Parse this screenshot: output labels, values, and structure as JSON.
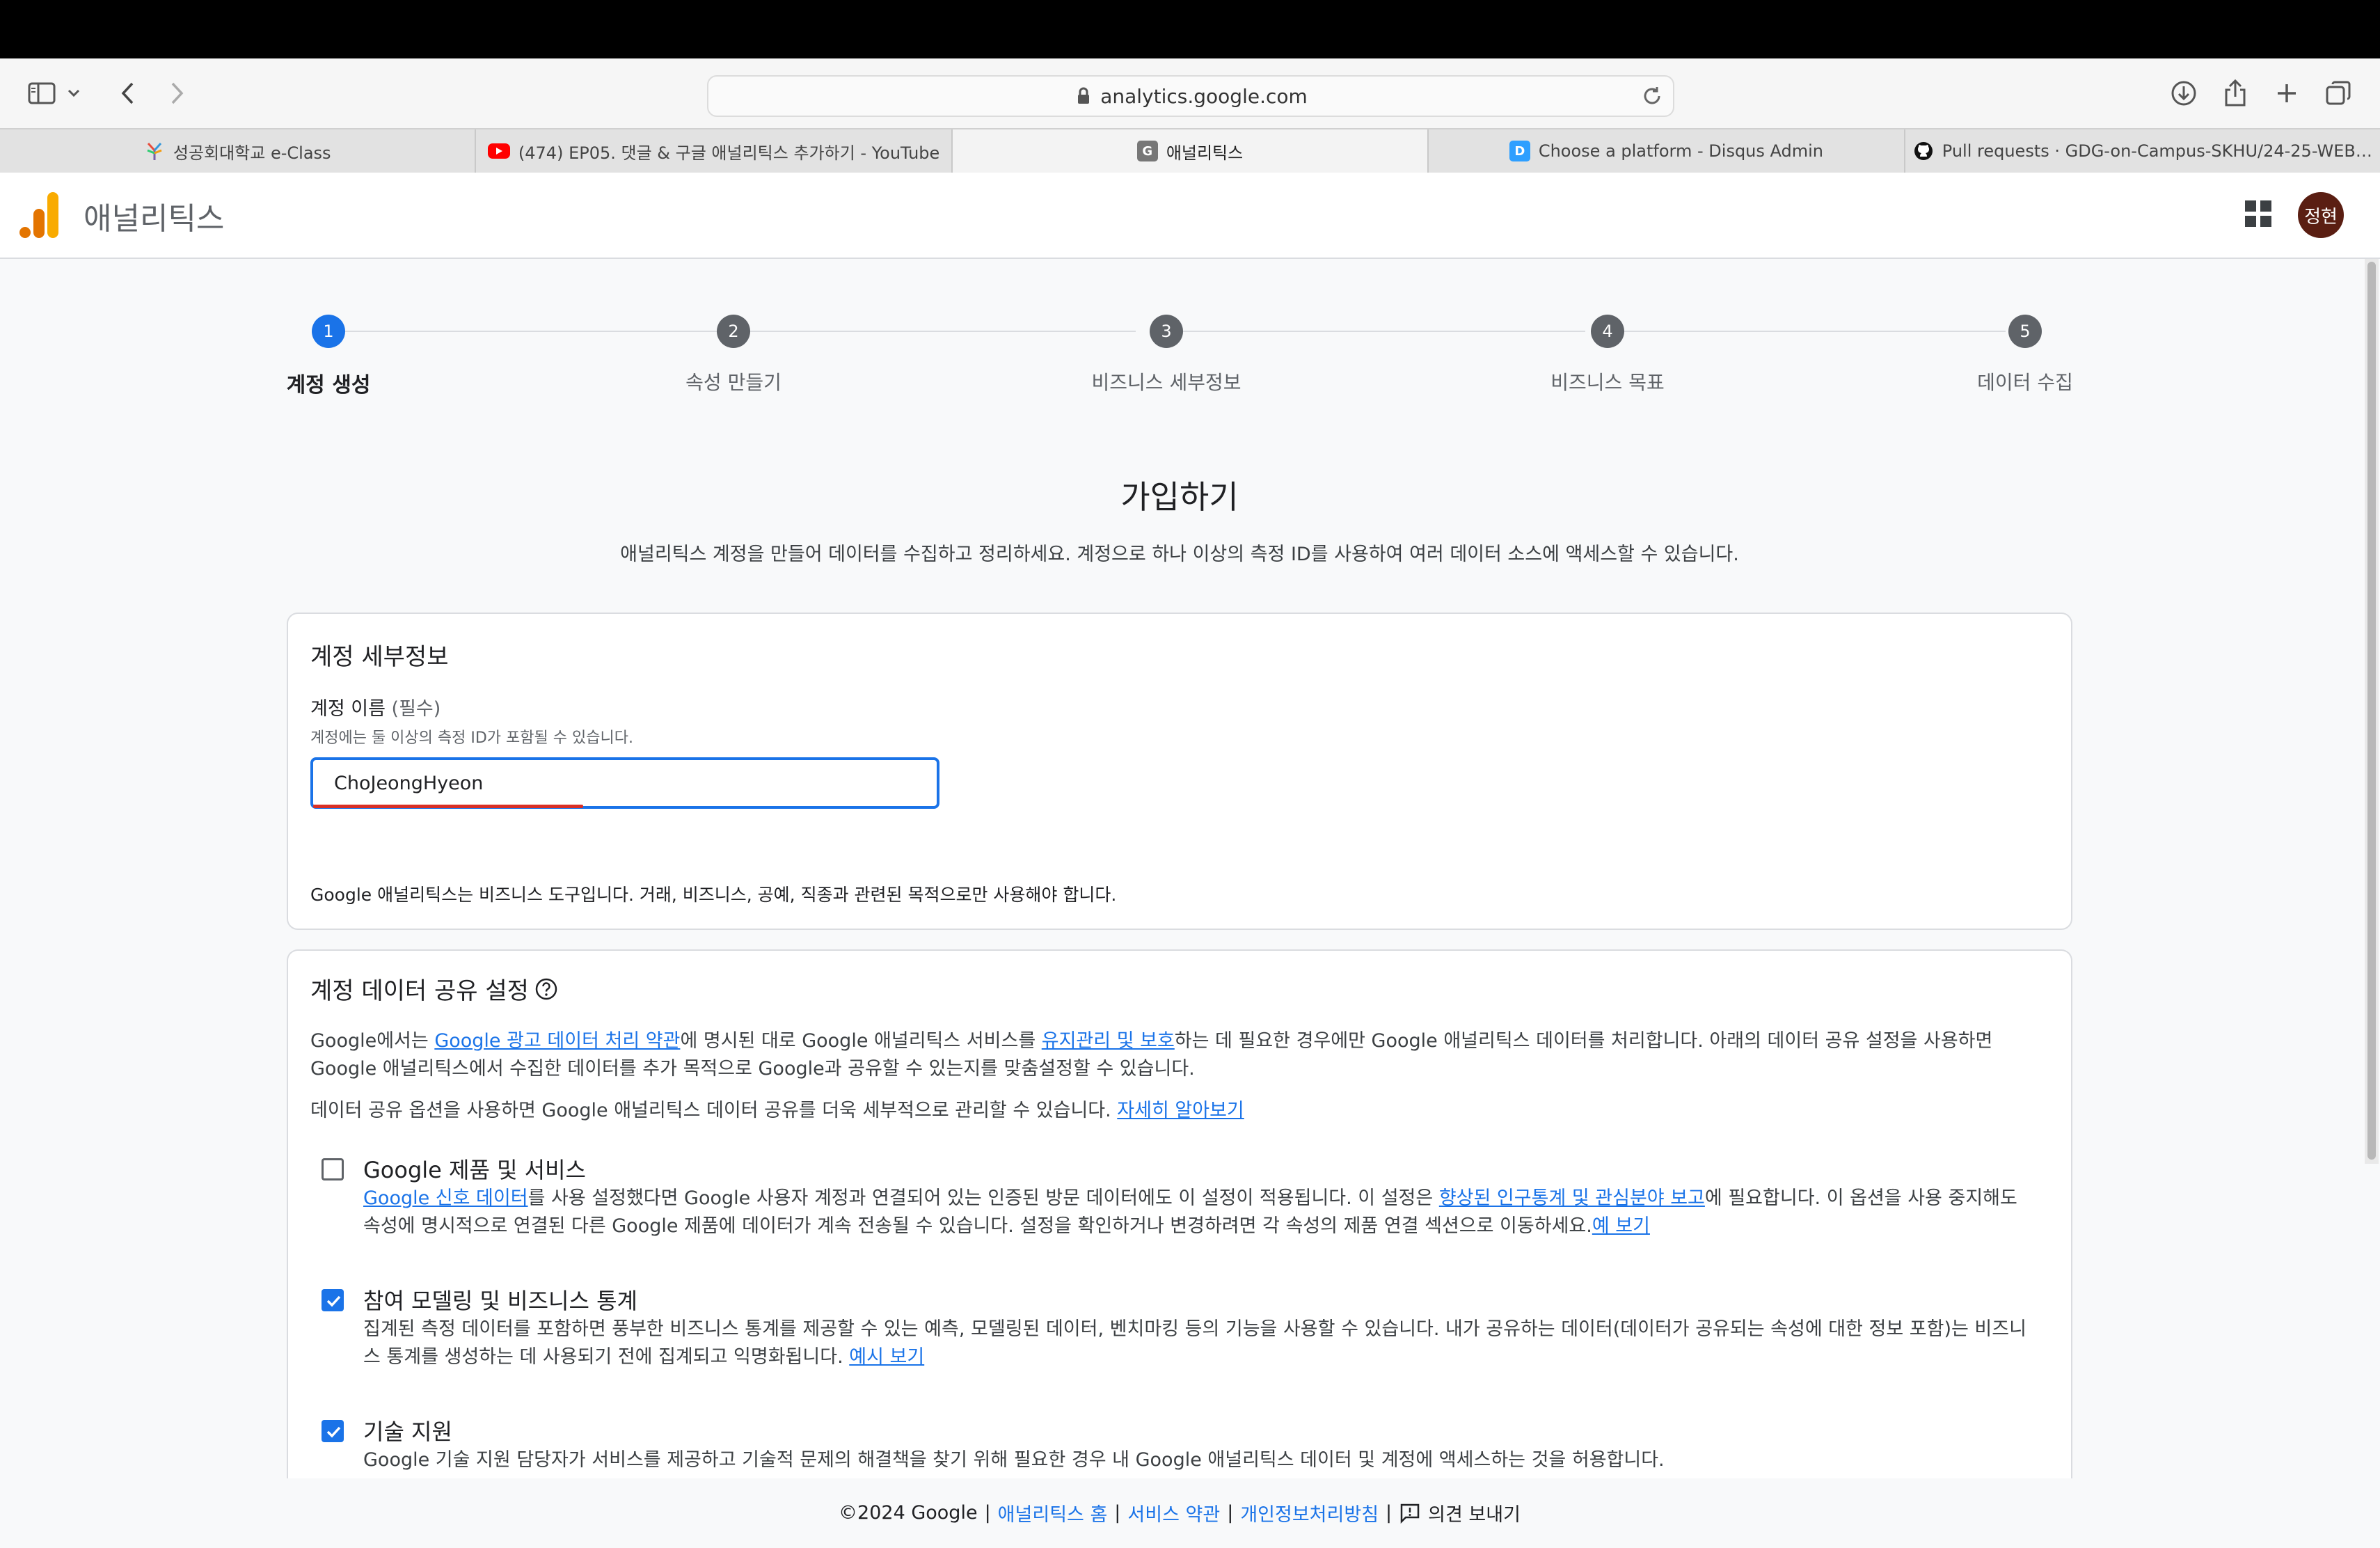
{
  "browser": {
    "url": "analytics.google.com",
    "tabs": [
      {
        "title": "성공회대학교 e-Class",
        "icon": "eclass-favicon"
      },
      {
        "title": "(474) EP05. 댓글 & 구글 애널리틱스 추가하기 - YouTube",
        "icon": "youtube-favicon"
      },
      {
        "title": "애널리틱스",
        "icon": "google-favicon",
        "active": true
      },
      {
        "title": "Choose a platform - Disqus Admin",
        "icon": "disqus-favicon"
      },
      {
        "title": "Pull requests · GDG-on-Campus-SKHU/24-25-WEB…",
        "icon": "github-favicon"
      }
    ]
  },
  "app": {
    "title": "애널리틱스",
    "avatar_text": "정현",
    "brand_colors": {
      "logo_orange": "#F9AB00",
      "logo_dark_orange": "#E37400",
      "primary": "#1a73e8"
    }
  },
  "stepper": {
    "steps": [
      {
        "number": "1",
        "label": "계정 생성",
        "active": true
      },
      {
        "number": "2",
        "label": "속성 만들기"
      },
      {
        "number": "3",
        "label": "비즈니스 세부정보"
      },
      {
        "number": "4",
        "label": "비즈니스 목표"
      },
      {
        "number": "5",
        "label": "데이터 수집"
      }
    ]
  },
  "header": {
    "title": "가입하기",
    "description": "애널리틱스 계정을 만들어 데이터를 수집하고 정리하세요. 계정으로 하나 이상의 측정 ID를 사용하여 여러 데이터 소스에 액세스할 수 있습니다."
  },
  "account_details": {
    "title": "계정 세부정보",
    "name_label": "계정 이름",
    "required_text": "(필수)",
    "hint": "계정에는 둘 이상의 측정 ID가 포함될 수 있습니다.",
    "name_value": "ChoJeongHyeon",
    "notice": "Google 애널리틱스는 비즈니스 도구입니다. 거래, 비즈니스, 공예, 직종과 관련된 목적으로만 사용해야 합니다."
  },
  "data_sharing": {
    "title": "계정 데이터 공유 설정",
    "intro": {
      "part1": "Google에서는 ",
      "link1": "Google 광고 데이터 처리 약관",
      "part2": "에 명시된 대로 Google 애널리틱스 서비스를 ",
      "link2": "유지관리 및 보호",
      "part3": "하는 데 필요한 경우에만 Google 애널리틱스 데이터를 처리합니다. 아래의 데이터 공유 설정을 사용하면 Google 애널리틱스에서 수집한 데이터를 추가 목적으로 Google과 공유할 수 있는지를 맞춤설정할 수 있습니다."
    },
    "more": {
      "text": "데이터 공유 옵션을 사용하면 Google 애널리틱스 데이터 공유를 더욱 세부적으로 관리할 수 있습니다. ",
      "link": "자세히 알아보기"
    },
    "options": [
      {
        "title": "Google 제품 및 서비스",
        "checked": false,
        "link_a": "Google 신호 데이터",
        "text_a": "를 사용 설정했다면 Google 사용자 계정과 연결되어 있는 인증된 방문 데이터에도 이 설정이 적용됩니다. 이 설정은 ",
        "link_b": "향상된 인구통계 및 관심분야 보고",
        "text_b": "에 필요합니다. 이 옵션을 사용 중지해도 속성에 명시적으로 연결된 다른 Google 제품에 데이터가 계속 전송될 수 있습니다. 설정을 확인하거나 변경하려면 각 속성의 제품 연결 섹션으로 이동하세요.",
        "link_c": "예 보기"
      },
      {
        "title": "참여 모델링 및 비즈니스 통계",
        "checked": true,
        "text": "집계된 측정 데이터를 포함하면 풍부한 비즈니스 통계를 제공할 수 있는 예측, 모델링된 데이터, 벤치마킹 등의 기능을 사용할 수 있습니다. 내가 공유하는 데이터(데이터가 공유되는 속성에 대한 정보 포함)는 비즈니스 통계를 생성하는 데 사용되기 전에 집계되고 익명화됩니다. ",
        "link": "예시 보기"
      },
      {
        "title": "기술 지원",
        "checked": true,
        "text": "Google 기술 지원 담당자가 서비스를 제공하고 기술적 문제의 해결책을 찾기 위해 필요한 경우 내 Google 애널리틱스 데이터 및 계정에 액세스하는 것을 허용합니다."
      }
    ]
  },
  "footer": {
    "copyright": "©2024 Google",
    "sep": "|",
    "links": [
      "애널리틱스 홈",
      "서비스 약관",
      "개인정보처리방침"
    ],
    "feedback": "의견 보내기"
  }
}
